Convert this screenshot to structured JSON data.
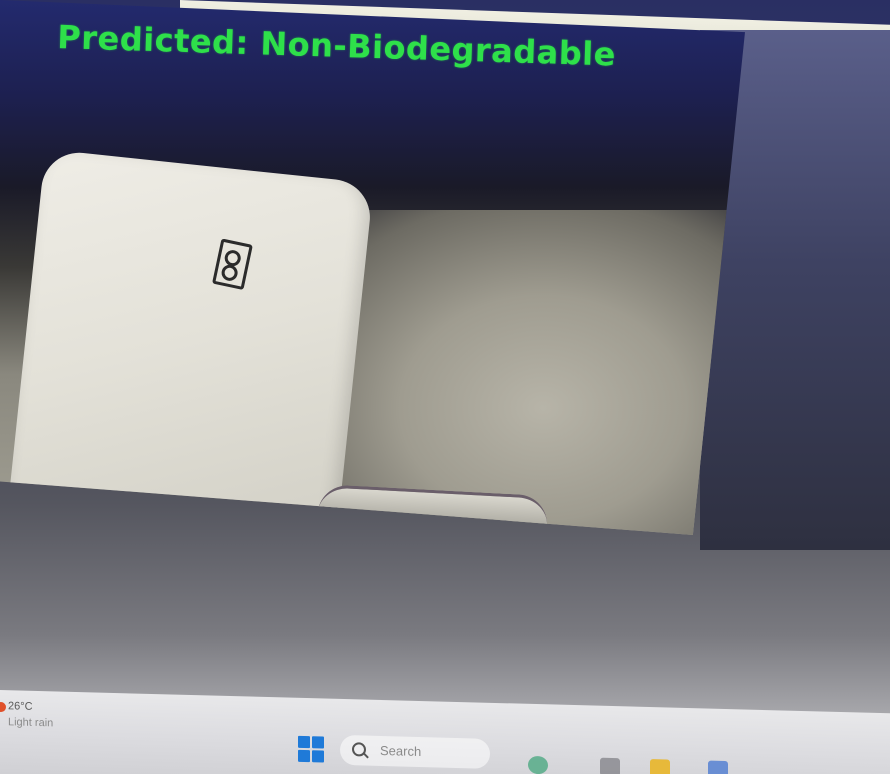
{
  "camera_window": {
    "prediction_label": "Predicted: Non-Biodegradable"
  },
  "taskbar": {
    "weather": {
      "temperature": "26°C",
      "condition": "Light rain",
      "icon": "weather-rain-icon"
    },
    "start": {
      "icon": "windows-start-icon"
    },
    "search": {
      "placeholder": "Search",
      "icon": "search-icon"
    },
    "pinned_apps": [
      {
        "icon": "recycle-icon"
      },
      {
        "icon": "app-icon"
      },
      {
        "icon": "folder-icon"
      },
      {
        "icon": "app-icon"
      }
    ]
  },
  "colors": {
    "prediction_text": "#2ee04a",
    "start_blue": "#1f7ad8"
  }
}
